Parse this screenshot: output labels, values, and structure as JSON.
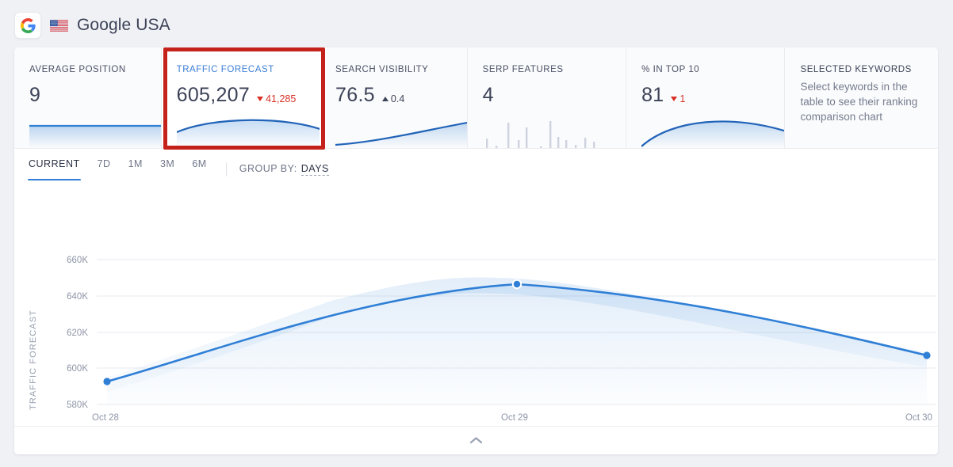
{
  "header": {
    "brand_icon": "google-g-icon",
    "flag_icon": "us-flag-icon",
    "title": "Google USA"
  },
  "highlight": {
    "color": "#c5211b"
  },
  "kpis": [
    {
      "label": "AVERAGE POSITION",
      "value": "9",
      "delta": "",
      "delta_dir": "none",
      "spark": "flat",
      "selected": false
    },
    {
      "label": "TRAFFIC FORECAST",
      "value": "605,207",
      "delta": "41,285",
      "delta_dir": "down",
      "spark": "hump",
      "selected": true
    },
    {
      "label": "SEARCH VISIBILITY",
      "value": "76.5",
      "delta": "0.4",
      "delta_dir": "up",
      "spark": "rise",
      "selected": false
    },
    {
      "label": "SERP FEATURES",
      "value": "4",
      "delta": "",
      "delta_dir": "none",
      "spark": "bars",
      "selected": false
    },
    {
      "label": "% IN TOP 10",
      "value": "81",
      "delta": "1",
      "delta_dir": "down",
      "spark": "hump2",
      "selected": false
    }
  ],
  "selected_keywords": {
    "label": "SELECTED KEYWORDS",
    "description": "Select keywords in the table to see their ranking comparison chart"
  },
  "toolbar": {
    "tabs": [
      {
        "label": "CURRENT",
        "active": true
      },
      {
        "label": "7D",
        "active": false
      },
      {
        "label": "1M",
        "active": false
      },
      {
        "label": "3M",
        "active": false
      },
      {
        "label": "6M",
        "active": false
      }
    ],
    "group_by_label": "GROUP BY:",
    "group_by_value": "DAYS"
  },
  "legend": [
    {
      "color": "#2f7fd6",
      "icons": [
        "google-g-icon",
        "us-flag-icon"
      ],
      "label": "USA"
    }
  ],
  "collapse": {
    "icon": "chevron-up-icon"
  },
  "chart_data": {
    "type": "line",
    "title": "",
    "xlabel": "",
    "ylabel": "TRAFFIC FORECAST",
    "series": [
      {
        "name": "USA",
        "color": "#2f7fd6",
        "x": [
          "Oct 28",
          "Oct 29",
          "Oct 30"
        ],
        "values": [
          592600,
          646500,
          605207
        ]
      }
    ],
    "categories": [
      "Oct 28",
      "Oct 29",
      "Oct 30"
    ],
    "x_tick_labels": [
      "Oct 28",
      "Oct 29",
      "Oct 30"
    ],
    "y_tick_labels": [
      "580K",
      "600K",
      "620K",
      "640K",
      "660K"
    ],
    "y_tick_values": [
      580000,
      600000,
      620000,
      640000,
      660000
    ],
    "ylim": [
      580000,
      660000
    ],
    "grid": true,
    "legend_position": "bottom-left",
    "markers": [
      {
        "x": "Oct 28",
        "y": 592600
      },
      {
        "x": "Oct 29",
        "y": 646500
      },
      {
        "x": "Oct 30",
        "y": 605207
      }
    ],
    "area_fill": true
  }
}
